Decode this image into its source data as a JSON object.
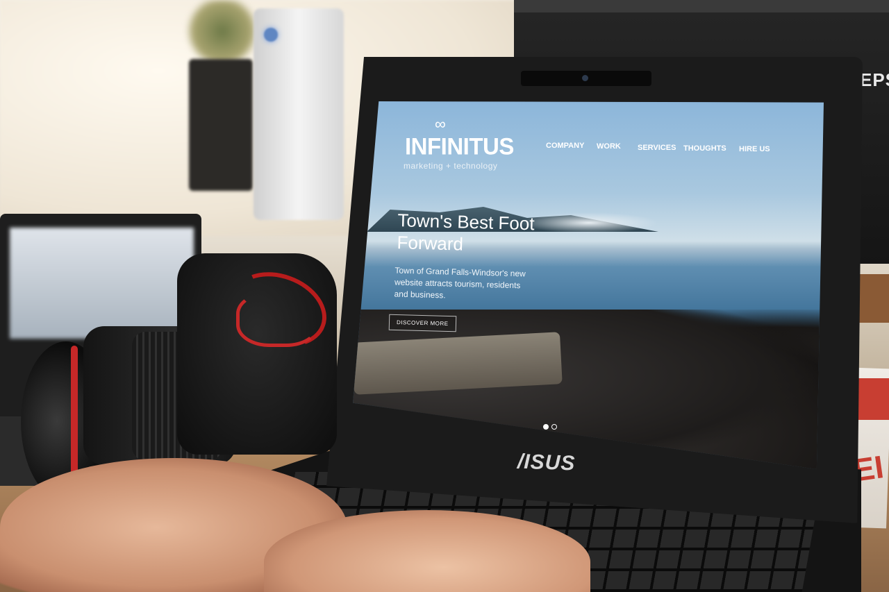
{
  "background": {
    "printer_brand": "EPS",
    "box_text": "XEI"
  },
  "laptop": {
    "brand": "/ISUS"
  },
  "website": {
    "logo": {
      "name": "INFINITUS",
      "tagline": "marketing + technology",
      "symbol": "∞"
    },
    "nav": {
      "items": [
        "COMPANY",
        "WORK",
        "SERVICES",
        "THOUGHTS",
        "HIRE US"
      ]
    },
    "hero": {
      "title": "Town's Best Foot Forward",
      "description": "Town of Grand Falls-Windsor's new website attracts tourism, residents and business.",
      "button_label": "DISCOVER MORE"
    },
    "slider": {
      "total": 2,
      "active": 1
    }
  }
}
